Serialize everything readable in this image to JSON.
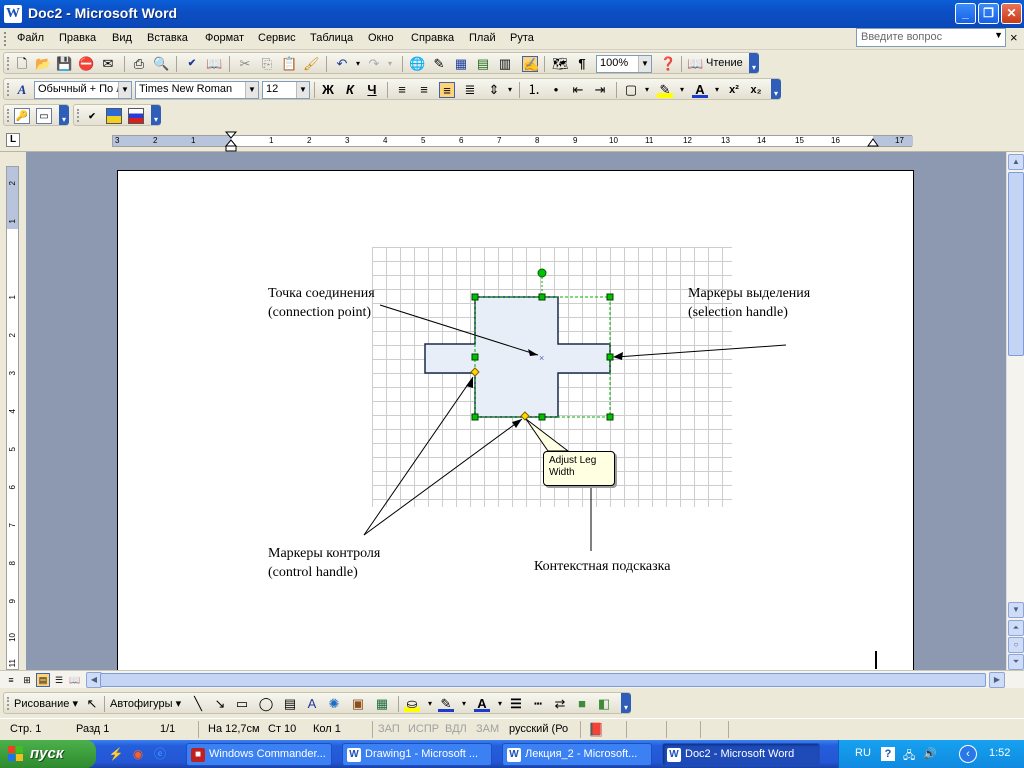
{
  "window": {
    "title": "Doc2 - Microsoft Word",
    "app_icon": "W",
    "minimize": "_",
    "maximize": "❐",
    "close": "✕"
  },
  "menu": {
    "items": [
      "Файл",
      "Правка",
      "Вид",
      "Вставка",
      "Формат",
      "Сервис",
      "Таблица",
      "Окно",
      "Справка",
      "Плай",
      "Рута"
    ],
    "ask_placeholder": "Введите вопрос",
    "doc_close": "×"
  },
  "standard_toolbar": {
    "zoom": "100%",
    "reading_label": "Чтение",
    "paragraph_mark": "¶"
  },
  "format_toolbar": {
    "style": "Обычный + По л",
    "font": "Times New Roman",
    "size": "12",
    "bold": "Ж",
    "italic": "К",
    "underline": "Ч",
    "font_color_letter": "А",
    "superscript": "x²",
    "subscript": "x₂"
  },
  "ruler": {
    "tab_button": "L",
    "h_ticks": [
      "3",
      "2",
      "1",
      "1",
      "2",
      "3",
      "4",
      "5",
      "6",
      "7",
      "8",
      "9",
      "10",
      "11",
      "12",
      "13",
      "14",
      "15",
      "16",
      "17"
    ],
    "v_ticks": [
      "2",
      "1",
      "1",
      "2",
      "3",
      "4",
      "5",
      "6",
      "7",
      "8",
      "9",
      "10",
      "11"
    ]
  },
  "figure": {
    "label_connection": [
      "Точка соединения",
      "(connection point)"
    ],
    "label_selection": [
      "Маркеры выделения",
      "(selection handle)"
    ],
    "label_control": [
      "Маркеры контроля",
      "(control handle)"
    ],
    "label_tooltip": "Контекстная подсказка",
    "tooltip": [
      "Adjust Leg",
      "Width"
    ],
    "colors": {
      "shape_fill": "#e8eef8",
      "handle": "#00c000",
      "control": "#ffd700",
      "rotate": "#00c000"
    }
  },
  "drawing_toolbar": {
    "draw": "Рисование ▾",
    "autoshapes": "Автофигуры ▾"
  },
  "status": {
    "page": "Стр. 1",
    "section": "Разд 1",
    "pages": "1/1",
    "at": "На 12,7см",
    "line": "Ст 10",
    "col": "Кол 1",
    "rec": "ЗАП",
    "trk": "ИСПР",
    "ext": "ВДЛ",
    "ovr": "ЗАМ",
    "language": "русский (Ро"
  },
  "taskbar": {
    "start": "пуск",
    "buttons": [
      "Windows Commander...",
      "Drawing1 - Microsoft ...",
      "Лекция_2 - Microsoft...",
      "Doc2 - Microsoft Word"
    ],
    "lang": "RU",
    "clock": "1:52"
  }
}
